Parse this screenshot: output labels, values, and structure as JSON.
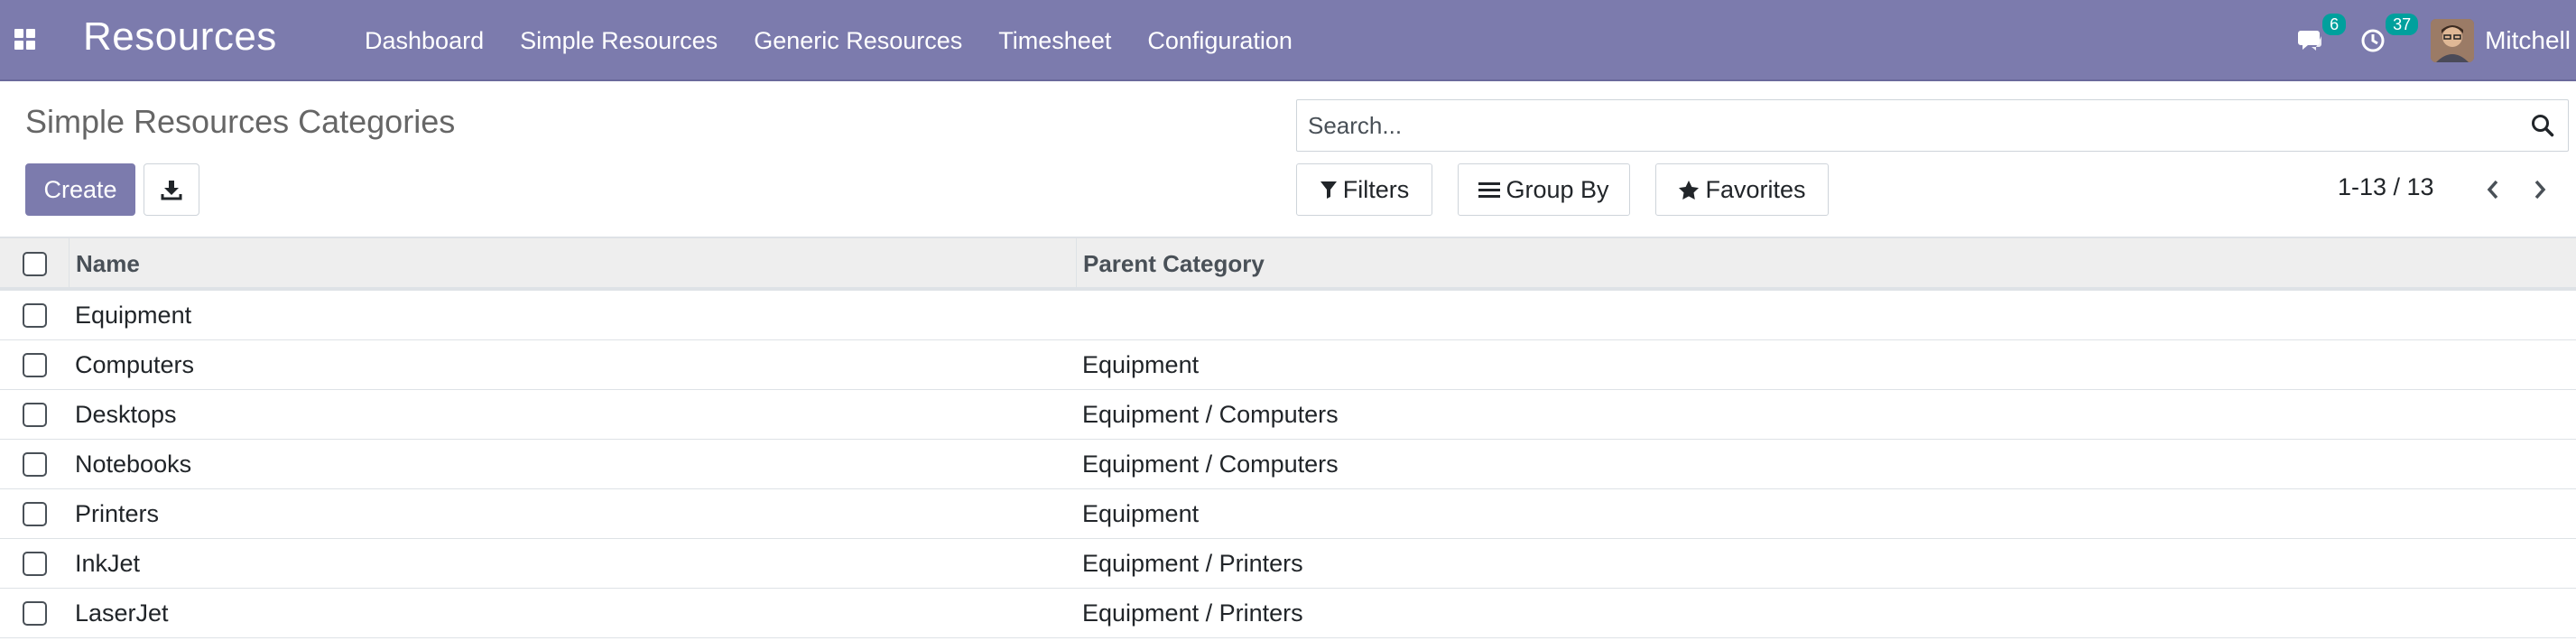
{
  "navbar": {
    "app_title": "Resources",
    "menu": [
      "Dashboard",
      "Simple Resources",
      "Generic Resources",
      "Timesheet",
      "Configuration"
    ],
    "messages_count": "6",
    "activities_count": "37",
    "user_name": "Mitchell"
  },
  "control_panel": {
    "page_title": "Simple Resources Categories",
    "create_label": "Create",
    "search_placeholder": "Search...",
    "filters_label": "Filters",
    "group_by_label": "Group By",
    "favorites_label": "Favorites",
    "pager_value": "1-13 / 13"
  },
  "table": {
    "columns": [
      "Name",
      "Parent Category"
    ],
    "rows": [
      {
        "name": "Equipment",
        "parent": ""
      },
      {
        "name": "Computers",
        "parent": "Equipment"
      },
      {
        "name": "Desktops",
        "parent": "Equipment / Computers"
      },
      {
        "name": "Notebooks",
        "parent": "Equipment / Computers"
      },
      {
        "name": "Printers",
        "parent": "Equipment"
      },
      {
        "name": "InkJet",
        "parent": "Equipment / Printers"
      },
      {
        "name": "LaserJet",
        "parent": "Equipment / Printers"
      }
    ]
  },
  "colors": {
    "navbar": "#7c7bad",
    "badge": "#00a09d",
    "header_bg": "#eeeeee"
  }
}
